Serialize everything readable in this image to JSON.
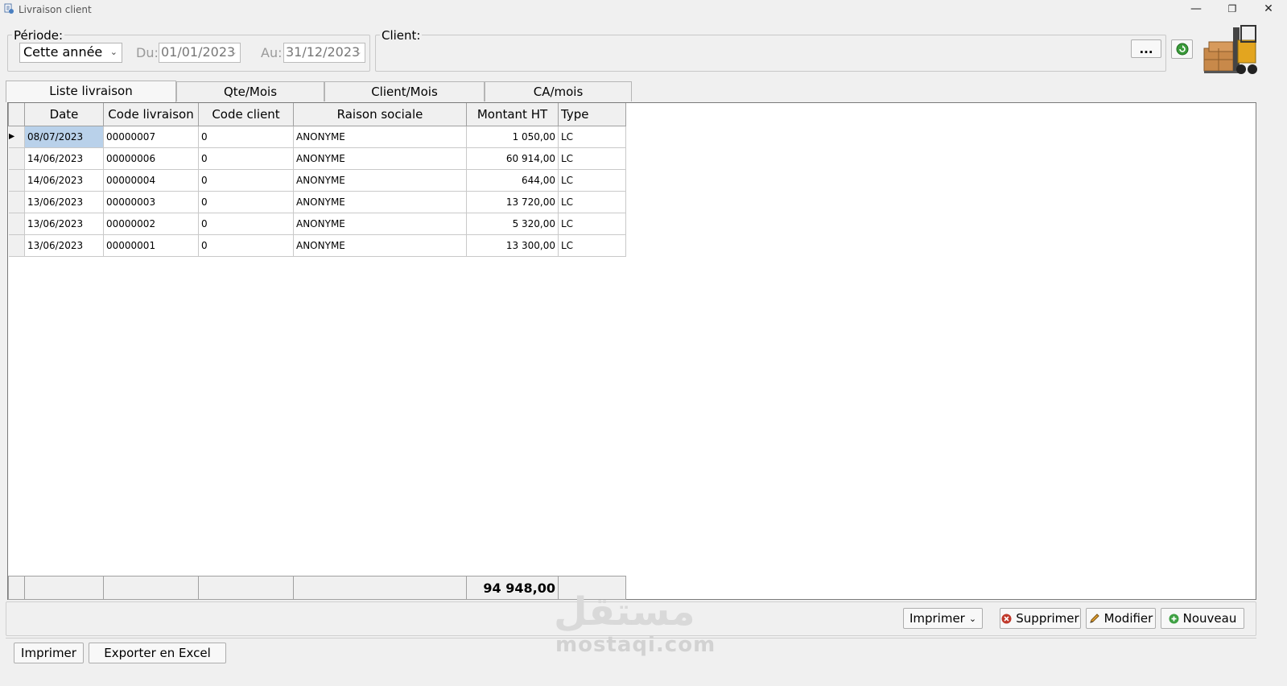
{
  "window": {
    "title": "Livraison client",
    "min_glyph": "—",
    "max_glyph": "❐",
    "close_glyph": "✕"
  },
  "periode": {
    "label": "Période:",
    "selected": "Cette année",
    "du_label": "Du:",
    "du_value": "01/01/2023",
    "au_label": "Au:",
    "au_value": "31/12/2023"
  },
  "client": {
    "label": "Client:",
    "browse_label": "...",
    "refresh_icon": "refresh-icon",
    "logo_icon": "forklift-boxes-icon"
  },
  "tabs": [
    {
      "label": "Liste livraison",
      "active": true
    },
    {
      "label": "Qte/Mois",
      "active": false
    },
    {
      "label": "Client/Mois",
      "active": false
    },
    {
      "label": "CA/mois",
      "active": false
    }
  ],
  "grid": {
    "columns": [
      "Date",
      "Code livraison",
      "Code client",
      "Raison sociale",
      "Montant HT",
      "Type"
    ],
    "rows": [
      {
        "date": "08/07/2023",
        "code_livraison": "00000007",
        "code_client": "0",
        "raison_sociale": "ANONYME",
        "montant_ht": "1 050,00",
        "type": "LC",
        "current": true
      },
      {
        "date": "14/06/2023",
        "code_livraison": "00000006",
        "code_client": "0",
        "raison_sociale": "ANONYME",
        "montant_ht": "60 914,00",
        "type": "LC"
      },
      {
        "date": "14/06/2023",
        "code_livraison": "00000004",
        "code_client": "0",
        "raison_sociale": "ANONYME",
        "montant_ht": "644,00",
        "type": "LC"
      },
      {
        "date": "13/06/2023",
        "code_livraison": "00000003",
        "code_client": "0",
        "raison_sociale": "ANONYME",
        "montant_ht": "13 720,00",
        "type": "LC"
      },
      {
        "date": "13/06/2023",
        "code_livraison": "00000002",
        "code_client": "0",
        "raison_sociale": "ANONYME",
        "montant_ht": "5 320,00",
        "type": "LC"
      },
      {
        "date": "13/06/2023",
        "code_livraison": "00000001",
        "code_client": "0",
        "raison_sociale": "ANONYME",
        "montant_ht": "13 300,00",
        "type": "LC"
      }
    ],
    "total_montant_ht": "94 948,00"
  },
  "actions": {
    "imprimer_menu": "Imprimer",
    "supprimer": "Supprimer",
    "modifier": "Modifier",
    "nouveau": "Nouveau"
  },
  "bottom": {
    "imprimer": "Imprimer",
    "exporter": "Exporter en Excel"
  },
  "watermark": {
    "arabic": "مستقل",
    "latin": "mostaqi.com"
  },
  "colors": {
    "selection": "#b9d1ea",
    "supprimer_icon": "#c0392b",
    "nouveau_icon": "#3ea043",
    "refresh_icon": "#3a9b3a"
  }
}
